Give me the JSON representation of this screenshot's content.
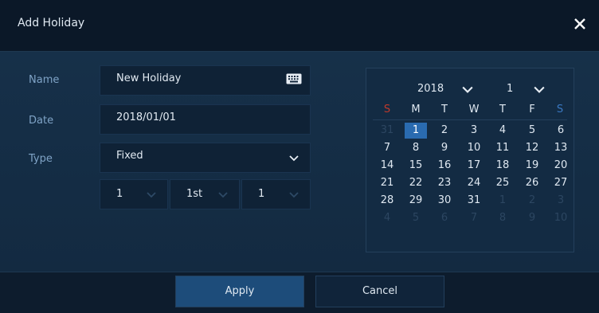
{
  "dialog": {
    "title": "Add Holiday"
  },
  "form": {
    "name_label": "Name",
    "name_value": "New Holiday",
    "date_label": "Date",
    "date_value": "2018/01/01",
    "type_label": "Type",
    "type_value": "Fixed",
    "recur": {
      "month": "1",
      "week": "1st",
      "day": "1"
    }
  },
  "calendar": {
    "year": "2018",
    "month": "1",
    "weekdays": [
      "S",
      "M",
      "T",
      "W",
      "T",
      "F",
      "S"
    ],
    "weeks": [
      [
        "31",
        "1",
        "2",
        "3",
        "4",
        "5",
        "6"
      ],
      [
        "7",
        "8",
        "9",
        "10",
        "11",
        "12",
        "13"
      ],
      [
        "14",
        "15",
        "16",
        "17",
        "18",
        "19",
        "20"
      ],
      [
        "21",
        "22",
        "23",
        "24",
        "25",
        "26",
        "27"
      ],
      [
        "28",
        "29",
        "30",
        "31",
        "1",
        "2",
        "3"
      ],
      [
        "4",
        "5",
        "6",
        "7",
        "8",
        "9",
        "10"
      ]
    ],
    "selected_day": "1"
  },
  "footer": {
    "apply_label": "Apply",
    "cancel_label": "Cancel"
  },
  "colors": {
    "accent": "#2a6bb0",
    "sunday": "#c0392b",
    "saturday": "#3a78c2"
  }
}
